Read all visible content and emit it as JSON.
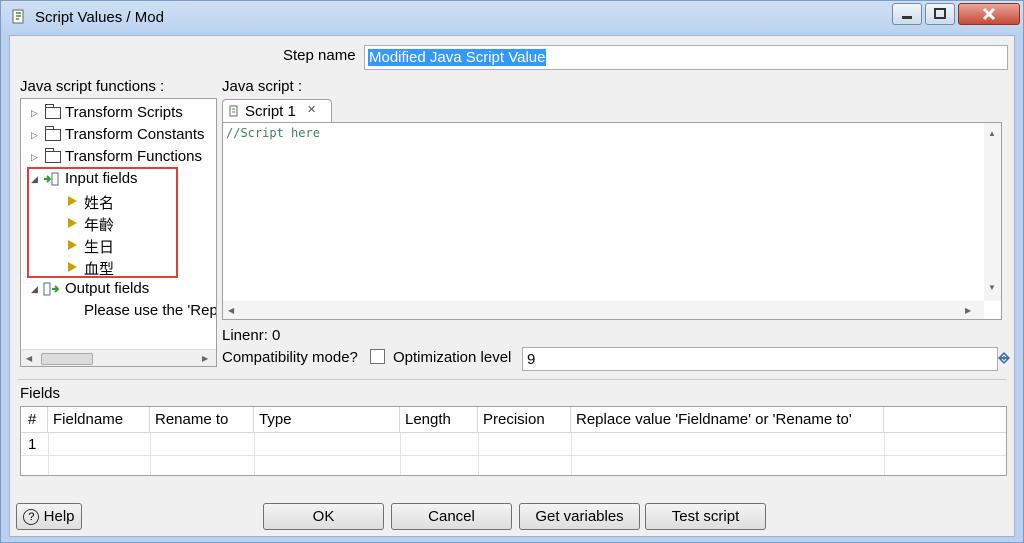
{
  "window": {
    "title": "Script Values / Mod"
  },
  "step": {
    "label": "Step name",
    "value": "Modified Java Script Value"
  },
  "functions": {
    "label": "Java script functions :",
    "tree": [
      {
        "label": "Transform Scripts"
      },
      {
        "label": "Transform Constants"
      },
      {
        "label": "Transform Functions"
      },
      {
        "label": "Input fields"
      },
      {
        "label": "姓名"
      },
      {
        "label": "年齡"
      },
      {
        "label": "生日"
      },
      {
        "label": "血型"
      },
      {
        "label": "Output fields"
      },
      {
        "label": "Please use the 'Rep"
      }
    ]
  },
  "script": {
    "label": "Java script :",
    "tab_label": "Script 1",
    "code": "//Script here",
    "linenr": "Linenr: 0"
  },
  "compat": {
    "label": "Compatibility mode?",
    "checked": false
  },
  "optimization": {
    "label": "Optimization level",
    "value": "9"
  },
  "fields": {
    "label": "Fields",
    "columns": [
      "#",
      "Fieldname",
      "Rename to",
      "Type",
      "Length",
      "Precision",
      "Replace value 'Fieldname' or 'Rename to'"
    ],
    "rows": [
      {
        "num": "1"
      }
    ]
  },
  "buttons": {
    "help": "Help",
    "ok": "OK",
    "cancel": "Cancel",
    "get_variables": "Get variables",
    "test_script": "Test script"
  },
  "colors": {
    "highlight": "#e0403a",
    "selection": "#3399ff",
    "field_icon": "#c9a200"
  }
}
